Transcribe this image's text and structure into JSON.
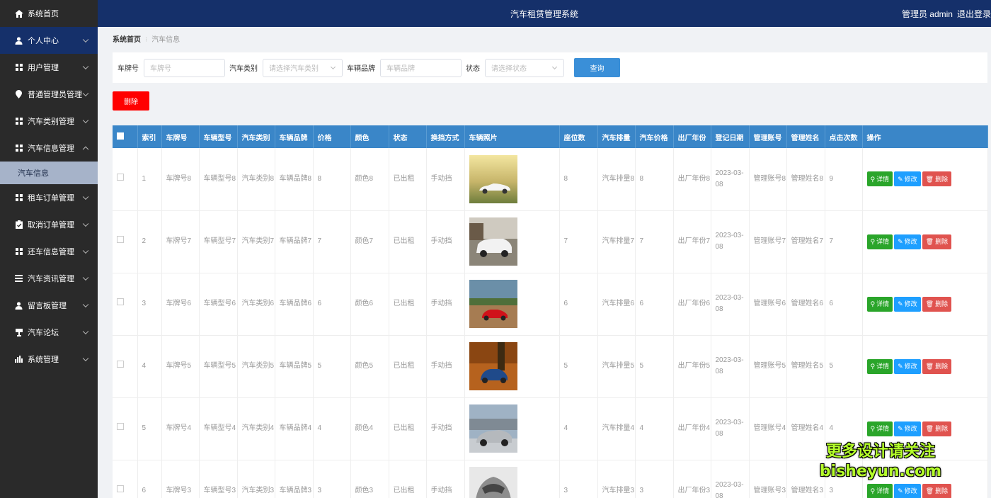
{
  "sidebar": {
    "items": [
      {
        "label": "系统首页",
        "icon": "home-icon"
      },
      {
        "label": "个人中心",
        "icon": "user-icon",
        "active": true
      },
      {
        "label": "用户管理",
        "icon": "grid-icon"
      },
      {
        "label": "普通管理员管理",
        "icon": "location-icon"
      },
      {
        "label": "汽车类别管理",
        "icon": "grid-icon"
      },
      {
        "label": "汽车信息管理",
        "icon": "grid-icon",
        "expanded": true,
        "sub": "汽车信息"
      },
      {
        "label": "租车订单管理",
        "icon": "grid-icon"
      },
      {
        "label": "取消订单管理",
        "icon": "clipboard-icon"
      },
      {
        "label": "还车信息管理",
        "icon": "grid-icon"
      },
      {
        "label": "汽车资讯管理",
        "icon": "list-icon"
      },
      {
        "label": "留言板管理",
        "icon": "user-icon"
      },
      {
        "label": "汽车论坛",
        "icon": "trophy-icon"
      },
      {
        "label": "系统管理",
        "icon": "bar-chart-icon"
      }
    ]
  },
  "header": {
    "title": "汽车租赁管理系统",
    "user": "管理员 admin",
    "logout": "退出登录"
  },
  "breadcrumb": {
    "home": "系统首页",
    "current": "汽车信息"
  },
  "search": {
    "plate_label": "车牌号",
    "plate_placeholder": "车牌号",
    "category_label": "汽车类别",
    "category_placeholder": "请选择汽车类别",
    "brand_label": "车辆品牌",
    "brand_placeholder": "车辆品牌",
    "status_label": "状态",
    "status_placeholder": "请选择状态",
    "query_button": "查询"
  },
  "delete_button": "删除",
  "table": {
    "headers": [
      "索引",
      "车牌号",
      "车辆型号",
      "汽车类别",
      "车辆品牌",
      "价格",
      "颜色",
      "状态",
      "换挡方式",
      "车辆照片",
      "座位数",
      "汽车排量",
      "汽车价格",
      "出厂年份",
      "登记日期",
      "管理账号",
      "管理姓名",
      "点击次数",
      "操作"
    ],
    "rows": [
      {
        "idx": "1",
        "plate": "车牌号8",
        "model": "车辆型号8",
        "category": "汽车类别8",
        "brand": "车辆品牌8",
        "price": "8",
        "color": "颜色8",
        "status": "已出租",
        "gear": "手动挡",
        "photo": "car-photo-white-convertible",
        "seats": "8",
        "disp": "汽车排量8",
        "carprice": "8",
        "year": "出厂年份8",
        "date": "2023-03-08",
        "acct": "管理账号8",
        "name": "管理姓名8",
        "clicks": "9"
      },
      {
        "idx": "2",
        "plate": "车牌号7",
        "model": "车辆型号7",
        "category": "汽车类别7",
        "brand": "车辆品牌7",
        "price": "7",
        "color": "颜色7",
        "status": "已出租",
        "gear": "手动挡",
        "photo": "car-photo-white-suv",
        "seats": "7",
        "disp": "汽车排量7",
        "carprice": "7",
        "year": "出厂年份7",
        "date": "2023-03-08",
        "acct": "管理账号7",
        "name": "管理姓名7",
        "clicks": "7"
      },
      {
        "idx": "3",
        "plate": "车牌号6",
        "model": "车辆型号6",
        "category": "汽车类别6",
        "brand": "车辆品牌6",
        "price": "6",
        "color": "颜色6",
        "status": "已出租",
        "gear": "手动挡",
        "photo": "car-photo-red-sports",
        "seats": "6",
        "disp": "汽车排量6",
        "carprice": "6",
        "year": "出厂年份6",
        "date": "2023-03-08",
        "acct": "管理账号6",
        "name": "管理姓名6",
        "clicks": "6"
      },
      {
        "idx": "4",
        "plate": "车牌号5",
        "model": "车辆型号5",
        "category": "汽车类别5",
        "brand": "车辆品牌5",
        "price": "5",
        "color": "颜色5",
        "status": "已出租",
        "gear": "手动挡",
        "photo": "car-photo-blue-rally",
        "seats": "5",
        "disp": "汽车排量5",
        "carprice": "5",
        "year": "出厂年份5",
        "date": "2023-03-08",
        "acct": "管理账号5",
        "name": "管理姓名5",
        "clicks": "5"
      },
      {
        "idx": "5",
        "plate": "车牌号4",
        "model": "车辆型号4",
        "category": "汽车类别4",
        "brand": "车辆品牌4",
        "price": "4",
        "color": "颜色4",
        "status": "已出租",
        "gear": "手动挡",
        "photo": "car-photo-silver-sedan",
        "seats": "4",
        "disp": "汽车排量4",
        "carprice": "4",
        "year": "出厂年份4",
        "date": "2023-03-08",
        "acct": "管理账号4",
        "name": "管理姓名4",
        "clicks": "4"
      },
      {
        "idx": "6",
        "plate": "车牌号3",
        "model": "车辆型号3",
        "category": "汽车类别3",
        "brand": "车辆品牌3",
        "price": "3",
        "color": "颜色3",
        "status": "已出租",
        "gear": "手动挡",
        "photo": "car-photo-silver-concept",
        "seats": "3",
        "disp": "汽车排量3",
        "carprice": "3",
        "year": "出厂年份3",
        "date": "2023-03-08",
        "acct": "管理账号3",
        "name": "管理姓名3",
        "clicks": "3"
      }
    ],
    "ops": {
      "detail": "详情",
      "edit": "修改",
      "delete": "删除"
    }
  },
  "watermark": {
    "line1": "更多设计请关注",
    "line2": "bisheyun.com"
  },
  "colors": {
    "header": "#15306a",
    "sidebar": "#2a2a2a",
    "table_header": "#3a86c8",
    "delete": "#ff0000",
    "detail": "#2aa52a",
    "edit": "#1e9fff",
    "remove": "#e0534f"
  }
}
